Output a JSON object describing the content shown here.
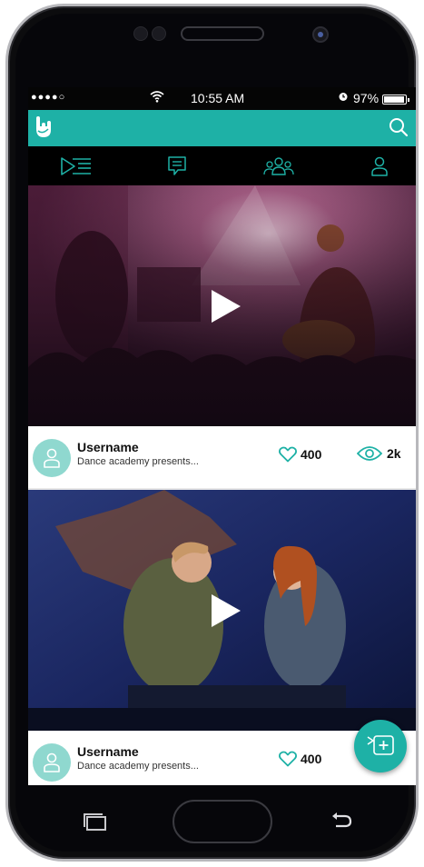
{
  "status_bar": {
    "signal": "●●●●○",
    "time": "10:55 AM",
    "battery": "97%"
  },
  "header": {
    "logo_icon": "rock-hand-logo",
    "search_icon": "search-icon"
  },
  "tabs": [
    {
      "name": "videos",
      "icon": "video-list-icon",
      "active": true
    },
    {
      "name": "messages",
      "icon": "chat-icon",
      "active": false
    },
    {
      "name": "community",
      "icon": "group-icon",
      "active": false
    },
    {
      "name": "profile",
      "icon": "user-icon",
      "active": false
    }
  ],
  "feed": [
    {
      "username": "Username",
      "description": "Dance academy presents...",
      "likes": "400",
      "views": "2k"
    },
    {
      "username": "Username",
      "description": "Dance academy presents...",
      "likes": "400",
      "views": ""
    }
  ],
  "colors": {
    "accent": "#1eb1a6",
    "avatar_bg": "#8fd8cf"
  }
}
